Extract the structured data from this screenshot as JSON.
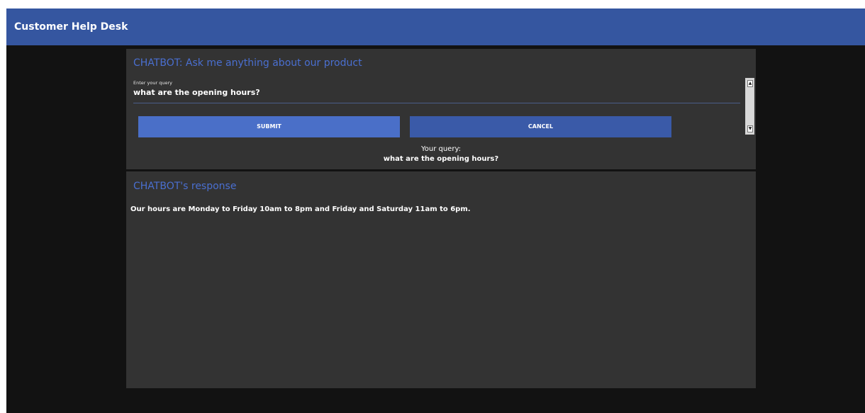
{
  "app": {
    "title": "Customer Help Desk"
  },
  "query_panel": {
    "heading": "CHATBOT: Ask me anything about our product",
    "field_label": "Enter your query",
    "field_value": "what are the opening hours?",
    "submit_label": "SUBMIT",
    "cancel_label": "CANCEL",
    "your_query_label": "Your query:",
    "your_query_value": "what are the opening hours?"
  },
  "response_panel": {
    "heading": "CHATBOT's response",
    "text": "Our hours are Monday to Friday 10am to 8pm and Friday and Saturday 11am to 6pm."
  },
  "colors": {
    "header_bar": "#3556a0",
    "background": "#121212",
    "panel": "#333333",
    "heading_text": "#4a6fd0",
    "submit_button": "#4a6fc8",
    "cancel_button": "#3a5aa8"
  },
  "icons": {
    "scroll_up": "scroll-up-arrow-icon",
    "scroll_down": "scroll-down-arrow-icon"
  }
}
